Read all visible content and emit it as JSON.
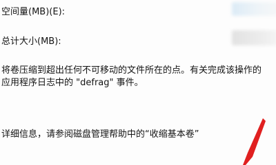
{
  "dialog": {
    "space_to_shrink_label": "空间量(MB)(E):",
    "total_size_after_label": "总计大小(MB):",
    "description_line1": "将卷压缩到超出任何不可移动的文件所在的点。有关完成该操作的",
    "description_line2": "应用程序日志中的 \"defrag\" 事件。",
    "help_text": "详细信息，请参阅磁盘管理帮助中的“收缩基本卷”"
  },
  "colors": {
    "annotation_arrow": "#e02020",
    "text": "#141414"
  }
}
